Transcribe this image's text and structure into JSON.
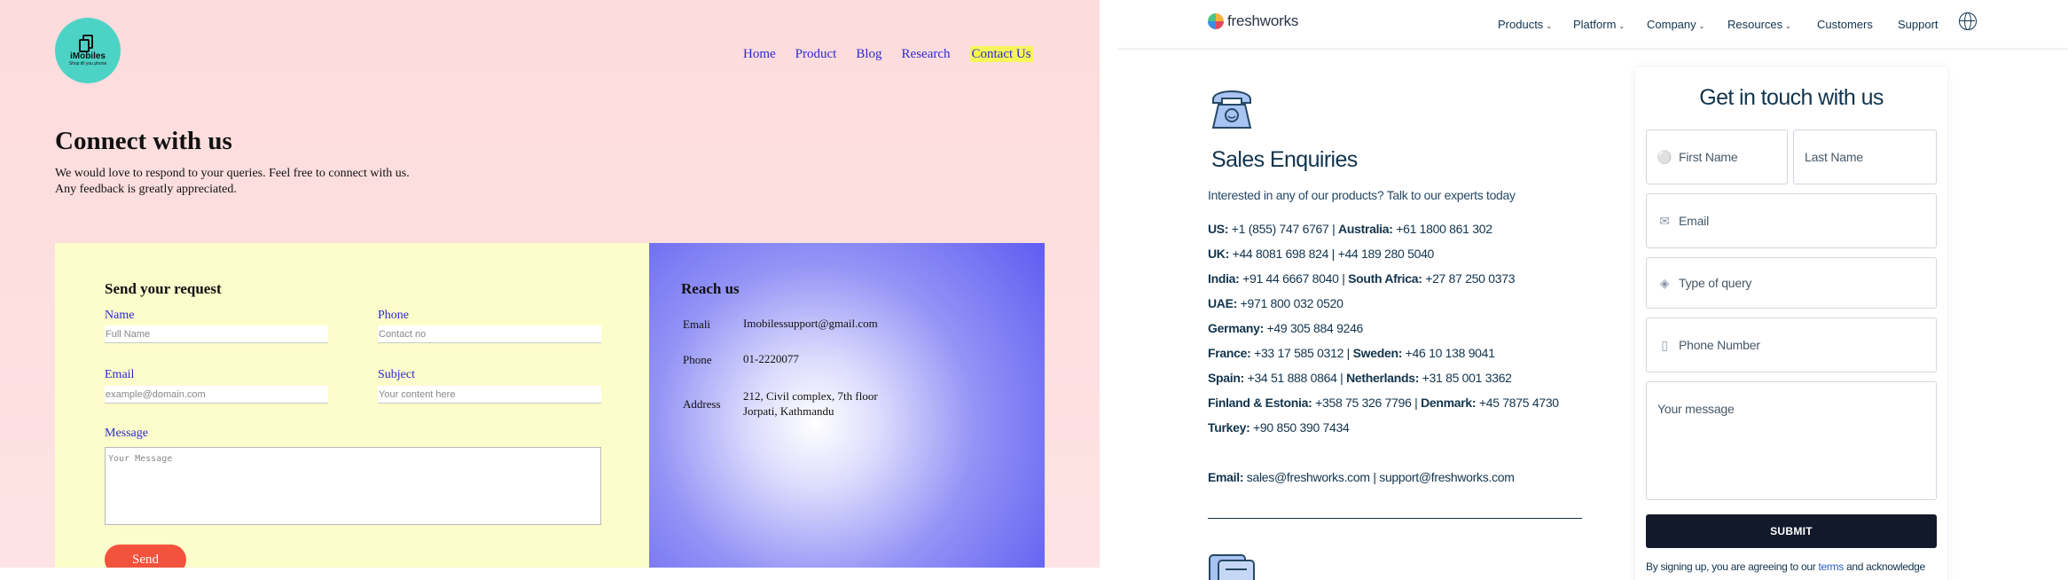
{
  "left": {
    "logo": {
      "brand": "iMobiles",
      "tagline": "Shop till you phone"
    },
    "nav": [
      "Home",
      "Product",
      "Blog",
      "Research",
      "Contact Us"
    ],
    "nav_active": "Contact Us",
    "title": "Connect with us",
    "subtitle_line1": "We would love to respond to your queries. Feel free to connect with us.",
    "subtitle_line2": "Any feedback is greatly appreciated.",
    "form": {
      "title": "Send your request",
      "name_label": "Name",
      "name_placeholder": "Full Name",
      "phone_label": "Phone",
      "phone_placeholder": "Contact no",
      "email_label": "Email",
      "email_placeholder": "example@domain.com",
      "subject_label": "Subject",
      "subject_placeholder": "Your content here",
      "message_label": "Message",
      "message_placeholder": "Your Message",
      "send_label": "Send"
    },
    "reach": {
      "title": "Reach us",
      "email_key": "Emali",
      "email_value": "Imobilessupport@gmail.com",
      "phone_key": "Phone",
      "phone_value": "01-2220077",
      "address_key": "Address",
      "address_line1": "212, Civil complex, 7th floor",
      "address_line2": "Jorpati, Kathmandu"
    },
    "colors": {
      "bg": "#fddcdd",
      "link": "#2c28d6",
      "highlight": "#f6f55a",
      "form_bg": "#fdfccb",
      "send": "#f3523c",
      "reach": "#5f5cf1"
    }
  },
  "right": {
    "logo_text": "freshworks",
    "nav": [
      {
        "label": "Products",
        "dropdown": true
      },
      {
        "label": "Platform",
        "dropdown": true
      },
      {
        "label": "Company",
        "dropdown": true
      },
      {
        "label": "Resources",
        "dropdown": true
      },
      {
        "label": "Customers",
        "dropdown": false
      },
      {
        "label": "Support",
        "dropdown": false
      }
    ],
    "chevron": "⌄",
    "globe_icon": "globe-icon",
    "sales_title": "Sales Enquiries",
    "sales_sub": "Interested in any of our products? Talk to our experts today",
    "contacts": [
      [
        {
          "k": "US:",
          "v": " +1 (855) 747 6767 | "
        },
        {
          "k": "Australia:",
          "v": " +61 1800 861 302"
        }
      ],
      [
        {
          "k": "UK:",
          "v": " +44 8081 698 824 | +44 189 280 5040"
        }
      ],
      [
        {
          "k": "India:",
          "v": " +91 44 6667 8040 | "
        },
        {
          "k": "South Africa:",
          "v": " +27 87 250 0373"
        }
      ],
      [
        {
          "k": "UAE:",
          "v": " +971 800 032 0520"
        }
      ],
      [
        {
          "k": "Germany:",
          "v": " +49 305 884 9246"
        }
      ],
      [
        {
          "k": "France:",
          "v": " +33 17 585 0312 | "
        },
        {
          "k": "Sweden:",
          "v": " +46 10 138 9041"
        }
      ],
      [
        {
          "k": "Spain:",
          "v": " +34 51 888 0864 | "
        },
        {
          "k": "Netherlands:",
          "v": " +31 85 001 3362"
        }
      ],
      [
        {
          "k": "Finland & Estonia:",
          "v": " +358 75 326 7796 | "
        },
        {
          "k": "Denmark:",
          "v": " +45 7875 4730"
        }
      ],
      [
        {
          "k": "Turkey:",
          "v": " +90 850 390 7434"
        }
      ]
    ],
    "email_line": [
      {
        "k": "Email:",
        "v": " sales@freshworks.com | support@freshworks.com"
      }
    ],
    "form": {
      "title": "Get in touch with us",
      "first_name": "First Name",
      "last_name": "Last Name",
      "email": "Email",
      "query": "Type of query",
      "phone": "Phone Number",
      "message": "Your message",
      "submit": "SUBMIT",
      "terms_pre": "By signing up, you are agreeing to our ",
      "terms_link": "terms",
      "terms_post": " and acknowledge"
    },
    "colors": {
      "navy": "#12344d",
      "button": "#12192b",
      "link": "#2c5cc5",
      "border": "#cfd7df"
    }
  }
}
